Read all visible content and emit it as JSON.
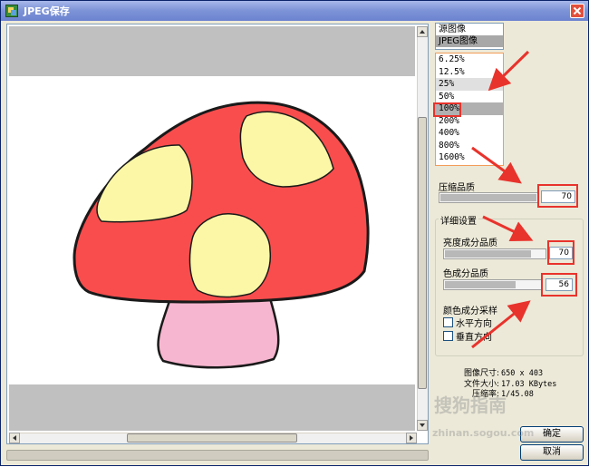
{
  "window": {
    "title": "JPEG保存"
  },
  "source_list": {
    "items": [
      "源图像",
      "JPEG图像"
    ],
    "selected_index": 1
  },
  "zoom_list": {
    "items": [
      "6.25%",
      "12.5%",
      "25%",
      "50%",
      "100%",
      "200%",
      "400%",
      "800%",
      "1600%"
    ],
    "selected_index": 4
  },
  "compression": {
    "label": "压缩品质",
    "value": "70",
    "level": 0.7
  },
  "details": {
    "title": "详细设置",
    "luminance": {
      "label": "亮度成分品质",
      "value": "70",
      "level": 0.7
    },
    "chroma": {
      "label": "色成分品质",
      "value": "56",
      "level": 0.56
    },
    "sampling": {
      "label": "颜色成分采样",
      "horizontal": "水平方向",
      "vertical": "垂直方向"
    }
  },
  "info": {
    "size_label": "图像尺寸:",
    "size_value": "650 x 403",
    "file_label": "文件大小:",
    "file_value": "17.03 KBytes",
    "ratio_label": "压缩率:",
    "ratio_value": "1/45.08"
  },
  "buttons": {
    "ok": "确定",
    "cancel": "取消"
  },
  "watermark": {
    "title": "搜狗指南",
    "url": "zhinan.sogou.com"
  },
  "colors": {
    "mushroom_cap": "#f94d4d",
    "mushroom_spots": "#fbf7a6",
    "mushroom_stem": "#f7b6cf",
    "annotation": "#e8332c"
  }
}
